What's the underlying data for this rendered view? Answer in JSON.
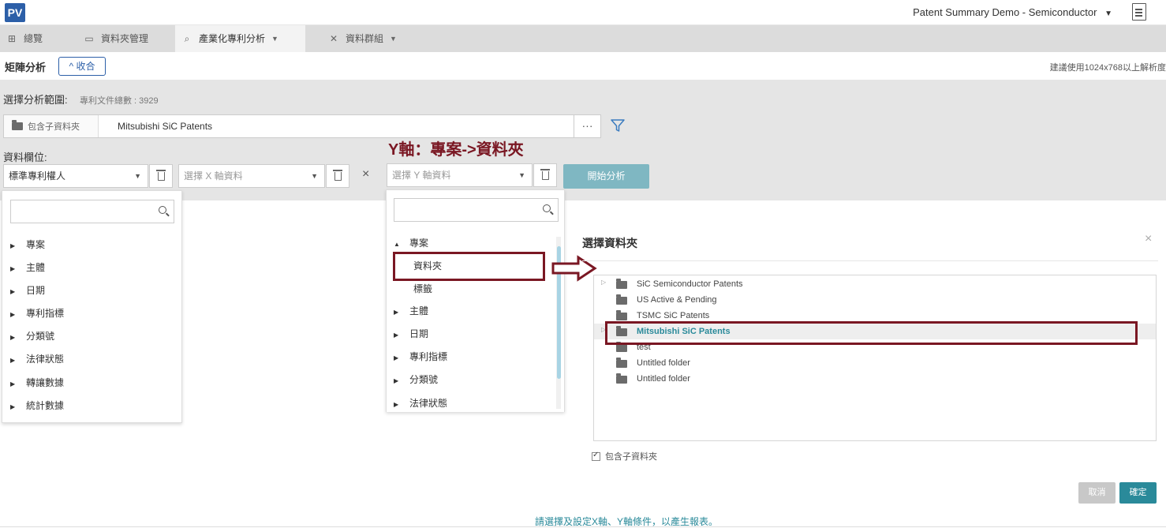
{
  "app": {
    "logo": "PV",
    "project_title": "Patent Summary Demo - Semiconductor"
  },
  "nav": {
    "tabs": [
      {
        "label": "總覽"
      },
      {
        "label": "資料夾管理"
      },
      {
        "label": "產業化專利分析"
      },
      {
        "label": "資料群組"
      }
    ]
  },
  "header": {
    "title": "矩陣分析",
    "collapse_label": "收合",
    "resolution_note": "建議使用1024x768以上解析度"
  },
  "scope": {
    "label": "選擇分析範圍:",
    "doc_count": "專利文件總數 : 3929",
    "include_sub_label": "包含子資料夾",
    "folder": "Mitsubishi SiC Patents",
    "more": "···"
  },
  "fields": {
    "label": "資料欄位:",
    "annotation": "Y軸：專案->資料夾",
    "field1": "標準專利權人",
    "x_placeholder": "選擇 X 軸資料",
    "y_placeholder": "選擇 Y 軸資料",
    "x_sep": "×",
    "start_label": "開始分析"
  },
  "left_dropdown": {
    "items": [
      "專案",
      "主體",
      "日期",
      "專利指標",
      "分類號",
      "法律狀態",
      "轉讓數據",
      "統計數據"
    ]
  },
  "right_dropdown": {
    "expanded": "專案",
    "sub_items": [
      "資料夾",
      "標籤"
    ],
    "items": [
      "主體",
      "日期",
      "專利指標",
      "分類號",
      "法律狀態"
    ]
  },
  "modal": {
    "title": "選擇資料夾",
    "close": "×",
    "folders": [
      {
        "name": "SiC Semiconductor Patents",
        "expandable": true,
        "selected": false
      },
      {
        "name": "US Active & Pending",
        "expandable": false,
        "selected": false
      },
      {
        "name": "TSMC SiC Patents",
        "expandable": false,
        "selected": false
      },
      {
        "name": "Mitsubishi SiC Patents",
        "expandable": true,
        "selected": true
      },
      {
        "name": "test",
        "expandable": false,
        "selected": false
      },
      {
        "name": "Untitled folder",
        "expandable": false,
        "selected": false
      },
      {
        "name": "Untitled folder",
        "expandable": false,
        "selected": false
      }
    ],
    "include_sub_label": "包含子資料夾",
    "cancel_label": "取消",
    "ok_label": "確定"
  },
  "footer": {
    "hint": "請選擇及設定X軸、Y軸條件，以產生報表。"
  },
  "colors": {
    "brand": "#2c5fa8",
    "accent": "#2a8a9a",
    "annotation": "#7a1723",
    "start_button": "#7fb7c2"
  }
}
